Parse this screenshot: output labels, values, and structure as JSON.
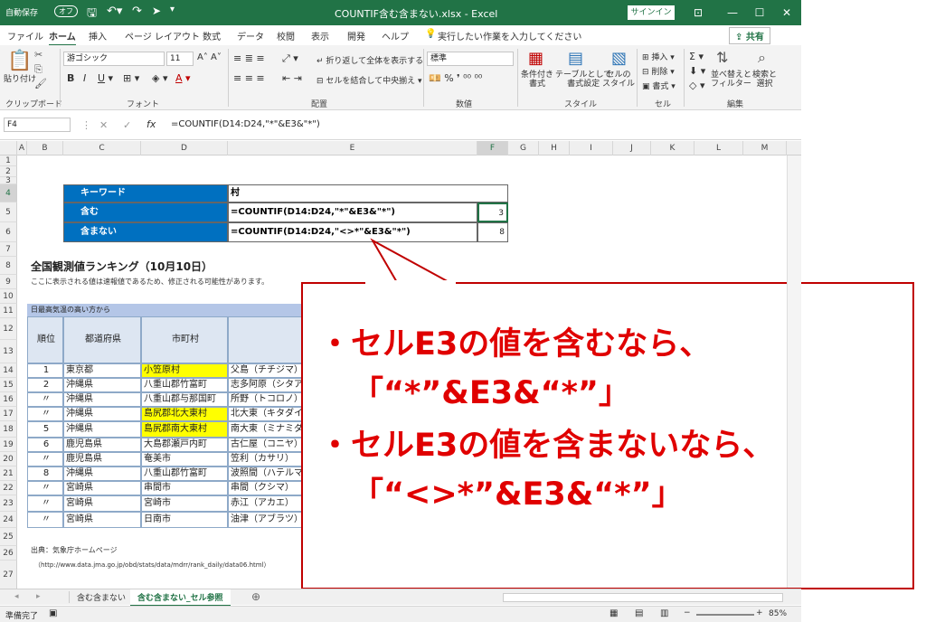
{
  "window": {
    "autosave_label": "自動保存",
    "autosave_state": "オフ",
    "title": "COUNTIF含む含まない.xlsx  -  Excel",
    "signin": "サインイン",
    "share": "共有"
  },
  "menu": [
    "ファイル",
    "ホーム",
    "挿入",
    "ページ レイアウト",
    "数式",
    "データ",
    "校閲",
    "表示",
    "開発",
    "ヘルプ"
  ],
  "tell_me": "実行したい作業を入力してください",
  "ribbon": {
    "paste": "貼り付け",
    "clipboard": "クリップボード",
    "font_name": "游ゴシック",
    "font_size": "11",
    "font_group": "フォント",
    "wrap_text": "折り返して全体を表示する",
    "merge_center": "セルを結合して中央揃え",
    "alignment_group": "配置",
    "number_format": "標準",
    "number_group": "数値",
    "conditional_format": "条件付き\n書式",
    "format_as_table": "テーブルとして\n書式設定",
    "cell_styles": "セルの\nスタイル",
    "styles_group": "スタイル",
    "insert": "挿入",
    "delete": "削除",
    "format": "書式",
    "cells_group": "セル",
    "sort_filter": "並べ替えと\nフィルター",
    "find_select": "検索と\n選択",
    "editing_group": "編集"
  },
  "formula_bar": {
    "name_box": "F4",
    "formula": "=COUNTIF(D14:D24,\"*\"&E3&\"*\")"
  },
  "columns": [
    "A",
    "B",
    "C",
    "D",
    "E",
    "F",
    "G",
    "H",
    "I",
    "J",
    "K",
    "L",
    "M"
  ],
  "rows": [
    "1",
    "2",
    "3",
    "4",
    "5",
    "6",
    "7",
    "8",
    "9",
    "10",
    "11",
    "12",
    "13",
    "14",
    "15",
    "16",
    "17",
    "18",
    "19",
    "20",
    "21",
    "22",
    "23",
    "24",
    "25",
    "26",
    "27"
  ],
  "keyword_table": {
    "r3_label": "キーワード",
    "r3_value": "村",
    "r4_label": "含む",
    "r4_formula": "=COUNTIF(D14:D24,\"*\"&E3&\"*\")",
    "r4_result": "3",
    "r5_label": "含まない",
    "r5_formula": "=COUNTIF(D14:D24,\"<>*\"&E3&\"*\")",
    "r5_result": "8"
  },
  "ranking": {
    "title": "全国観測値ランキング（10月10日）",
    "note": "ここに表示される値は速報値であるため、修正される可能性があります。",
    "section": "日最高気温の高い方から",
    "headers": [
      "順位",
      "都道府県",
      "市町村",
      ""
    ],
    "rows": [
      [
        "1",
        "東京都",
        "小笠原村",
        "父島（チチジマ）*"
      ],
      [
        "2",
        "沖縄県",
        "八重山郡竹富町",
        "志多阿原（シタアバ"
      ],
      [
        "〃",
        "沖縄県",
        "八重山郡与那国町",
        "所野（トコロノ）"
      ],
      [
        "〃",
        "沖縄県",
        "島尻郡北大東村",
        "北大東（キタダイト"
      ],
      [
        "5",
        "沖縄県",
        "島尻郡南大東村",
        "南大東（ミナミダイ"
      ],
      [
        "6",
        "鹿児島県",
        "大島郡瀬戸内町",
        "古仁屋（コニヤ）"
      ],
      [
        "〃",
        "鹿児島県",
        "奄美市",
        "笠利（カサリ）"
      ],
      [
        "8",
        "沖縄県",
        "八重山郡竹富町",
        "波照間（ハテルマ）"
      ],
      [
        "〃",
        "宮崎県",
        "串間市",
        "串間（クシマ）"
      ],
      [
        "〃",
        "宮崎県",
        "宮崎市",
        "赤江（アカエ）"
      ],
      [
        "〃",
        "宮崎県",
        "日南市",
        "油津（アブラツ）*"
      ]
    ],
    "source_label": "出典：気象庁ホームページ",
    "source_url": "（http://www.data.jma.go.jp/obd/stats/data/mdrr/rank_daily/data06.html）"
  },
  "callout": {
    "line1": "・セルE3の値を含むなら、",
    "line2": "「“*”&E3&“*”」",
    "line3": "・セルE3の値を含まないなら、",
    "line4": "「“<>*”&E3&“*”」"
  },
  "sheet_tabs": [
    "含む含まない",
    "含む含まない_セル参照"
  ],
  "status": {
    "ready": "準備完了",
    "zoom": "85%"
  }
}
